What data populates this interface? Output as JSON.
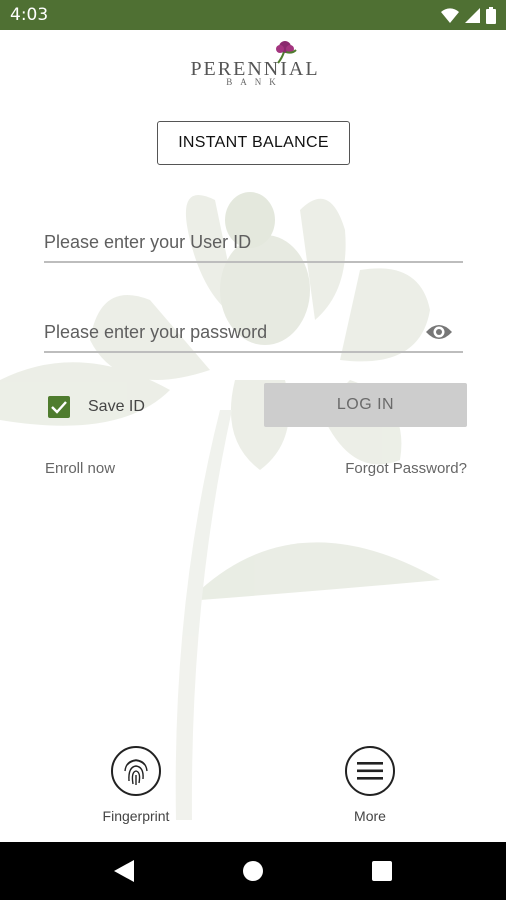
{
  "status_bar": {
    "time": "4:03",
    "icons": [
      "wifi-icon",
      "signal-icon",
      "battery-icon"
    ],
    "background": "#4f7033"
  },
  "logo": {
    "name": "PERENNIAL",
    "sub": "BANK"
  },
  "instant_balance_label": "INSTANT BALANCE",
  "login_form": {
    "user_id_placeholder": "Please enter your User ID",
    "password_placeholder": "Please enter your password",
    "save_id_label": "Save ID",
    "save_id_checked": true,
    "login_label": "LOG IN",
    "enroll_label": "Enroll now",
    "forgot_label": "Forgot Password?"
  },
  "bottom_actions": {
    "fingerprint_label": "Fingerprint",
    "more_label": "More"
  },
  "colors": {
    "accent": "#4f7c2e",
    "button_disabled": "#cdcdcd"
  },
  "nav_bar": {
    "icons": [
      "back-icon",
      "home-icon",
      "recents-icon"
    ]
  }
}
